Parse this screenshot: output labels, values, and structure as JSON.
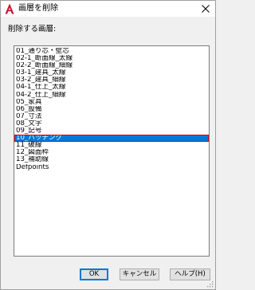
{
  "window": {
    "title": "画層を削除",
    "app_icon": "autocad-a-icon",
    "close_icon": "close-icon"
  },
  "prompt": "削除する画層:",
  "layers": [
    "01_通り芯・壁芯",
    "02-1_断面線_太線",
    "02-2_断面線_細線",
    "03-1_建具_太線",
    "03-2_建具_細線",
    "04-1_仕上_太線",
    "04-2_仕上_細線",
    "05_家具",
    "06_設備",
    "07_寸法",
    "08_文字",
    "09_記号",
    "10_ハッチング",
    "11_破線",
    "12_図面枠",
    "13_補助線",
    "Defpoints"
  ],
  "selected_index": 12,
  "buttons": {
    "ok": "OK",
    "cancel": "キャンセル",
    "help": "ヘルプ(H)"
  },
  "colors": {
    "selection_bg": "#0078d7",
    "selection_outline": "#c0101d",
    "app_icon_red": "#c8102e"
  }
}
